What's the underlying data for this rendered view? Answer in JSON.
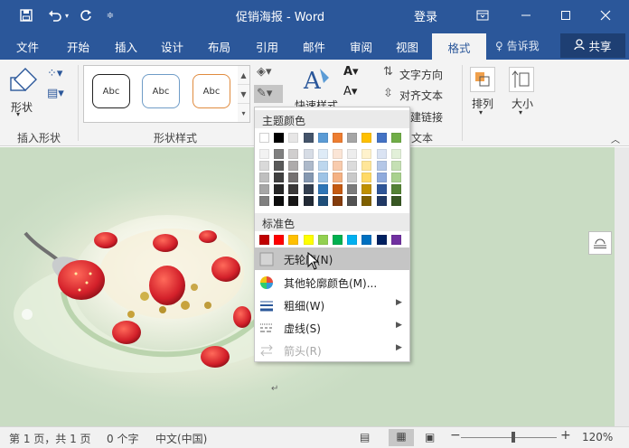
{
  "titlebar": {
    "title": "促销海报 - Word",
    "login": "登录",
    "quick_access": [
      "save-icon",
      "undo-icon",
      "redo-icon",
      "customize-icon"
    ]
  },
  "tabs": [
    "文件",
    "开始",
    "插入",
    "设计",
    "布局",
    "引用",
    "邮件",
    "审阅",
    "视图"
  ],
  "active_tab": "格式",
  "tell_me": "告诉我",
  "share": "共享",
  "ribbon": {
    "insert_shapes": {
      "shape_label": "形状",
      "group_label": "插入形状"
    },
    "shape_styles": {
      "gallery": [
        "Abc",
        "Abc",
        "Abc"
      ],
      "group_label": "形状样式"
    },
    "quick_styles": "快速样式",
    "text_direction": "文字方向",
    "align_text": "对齐文本",
    "create_link": "建链接",
    "text_group_label": "文本",
    "arrange": "排列",
    "size": "大小"
  },
  "dropdown": {
    "theme_colors_header": "主题颜色",
    "standard_colors_header": "标准色",
    "theme_top_row": [
      "#ffffff",
      "#000000",
      "#e7e6e6",
      "#44546a",
      "#5b9bd5",
      "#ed7d31",
      "#a5a5a5",
      "#ffc000",
      "#4472c4",
      "#70ad47"
    ],
    "theme_shades": [
      [
        "#f2f2f2",
        "#d9d9d9",
        "#bfbfbf",
        "#a6a6a6",
        "#808080"
      ],
      [
        "#7f7f7f",
        "#595959",
        "#404040",
        "#262626",
        "#0d0d0d"
      ],
      [
        "#d0cece",
        "#aeabab",
        "#757171",
        "#3a3838",
        "#171616"
      ],
      [
        "#d6dce5",
        "#adb9ca",
        "#8497b0",
        "#333f50",
        "#222a35"
      ],
      [
        "#deebf7",
        "#bdd7ee",
        "#9dc3e6",
        "#2e75b6",
        "#1f4e79"
      ],
      [
        "#fbe5d6",
        "#f8cbad",
        "#f4b183",
        "#c55a11",
        "#843c0c"
      ],
      [
        "#ededed",
        "#dbdbdb",
        "#c9c9c9",
        "#7b7b7b",
        "#525252"
      ],
      [
        "#fff2cc",
        "#ffe699",
        "#ffd966",
        "#bf9000",
        "#7f6000"
      ],
      [
        "#dae3f3",
        "#b4c7e7",
        "#8faadc",
        "#2f5597",
        "#203864"
      ],
      [
        "#e2f0d9",
        "#c5e0b4",
        "#a9d18e",
        "#548235",
        "#385723"
      ]
    ],
    "standard_colors": [
      "#c00000",
      "#ff0000",
      "#ffc000",
      "#ffff00",
      "#92d050",
      "#00b050",
      "#00b0f0",
      "#0070c0",
      "#002060",
      "#7030a0"
    ],
    "no_outline": "无轮廓(N)",
    "more_colors": "其他轮廓颜色(M)...",
    "weight": "粗细(W)",
    "dashes": "虚线(S)",
    "arrows": "箭头(R)"
  },
  "status": {
    "page": "第 1 页，共 1 页",
    "words": "0 个字",
    "language": "中文(中国)",
    "zoom": "120%",
    "zoom_minus": "−",
    "zoom_plus": "+"
  },
  "doc": {
    "paragraph_mark": "↵"
  }
}
